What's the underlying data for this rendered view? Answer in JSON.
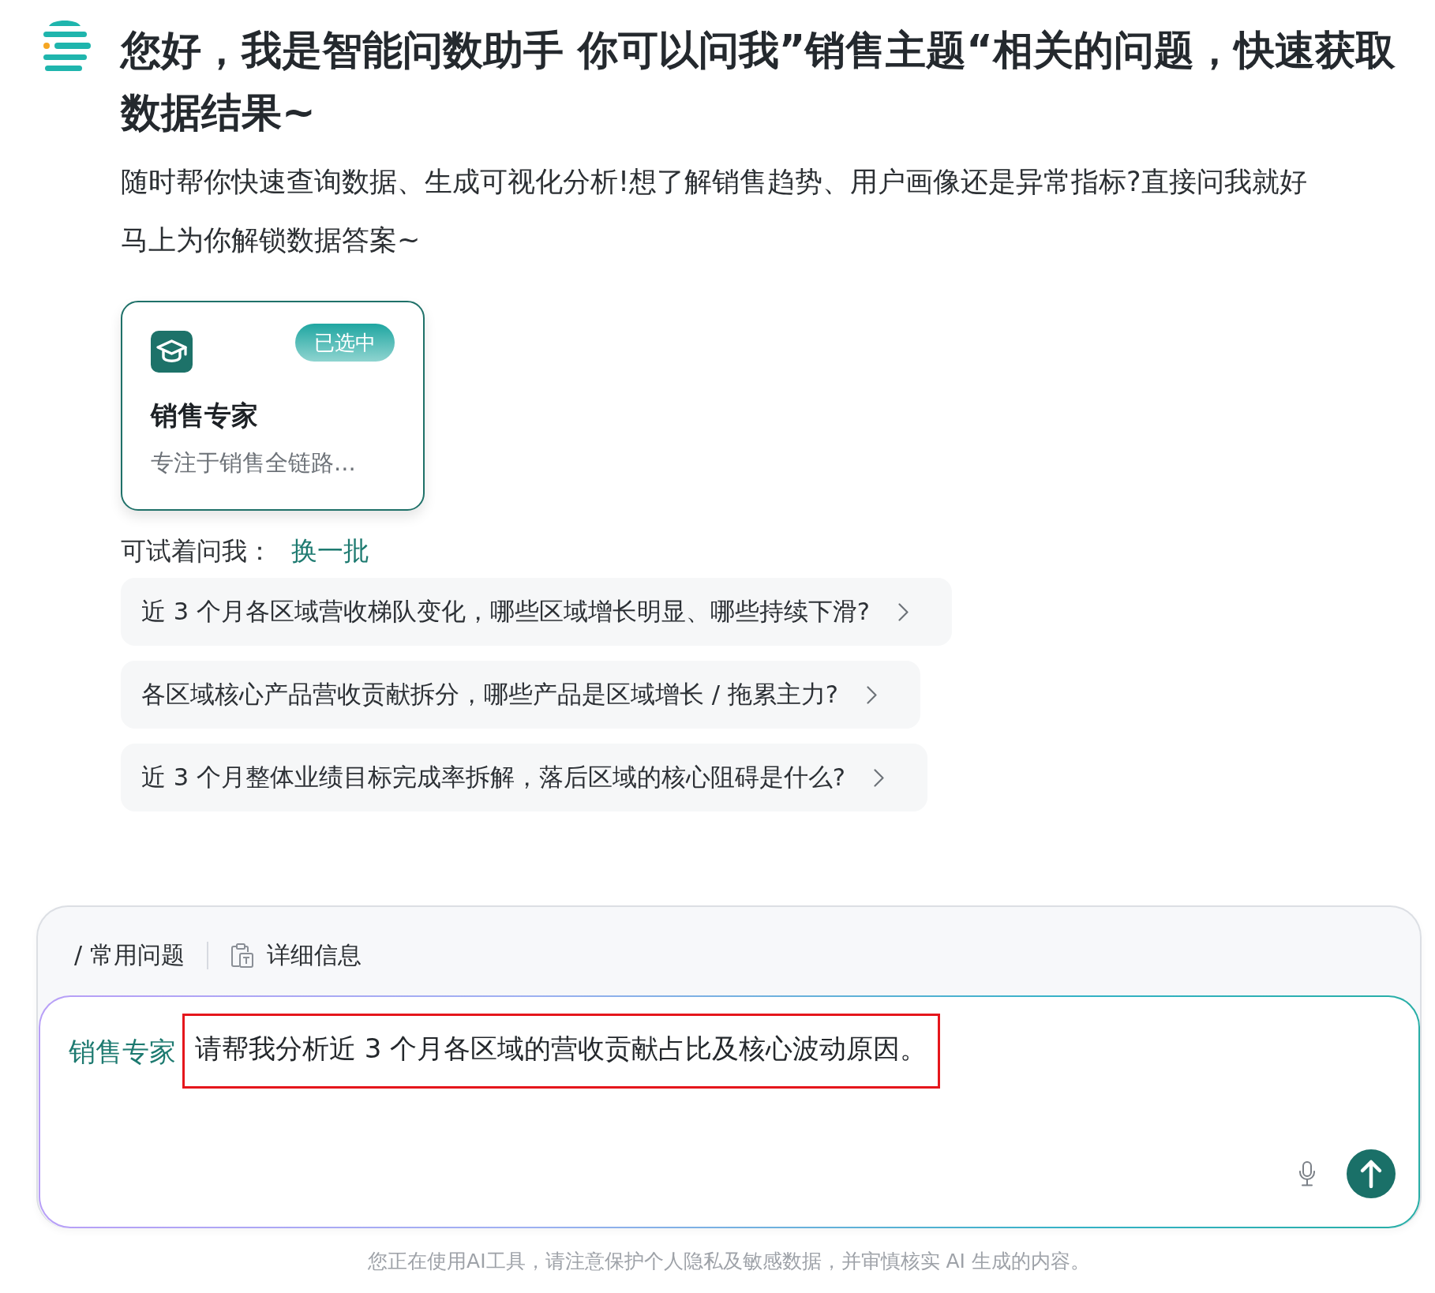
{
  "assistant": {
    "greeting": "您好，我是智能问数助手 你可以问我”销售主题“相关的问题，快速获取数据结果~",
    "intro": "随时帮你快速查询数据、生成可视化分析!想了解销售趋势、用户画像还是异常指标?直接问我就好马上为你解锁数据答案~"
  },
  "experts": [
    {
      "name": "销售专家",
      "description": "专注于销售全链路...",
      "badge": "已选中",
      "selected": true
    }
  ],
  "suggestions": {
    "label": "可试着问我：",
    "refresh": "换一批",
    "items": [
      "近 3 个月各区域营收梯队变化，哪些区域增长明显、哪些持续下滑?",
      "各区域核心产品营收贡献拆分，哪些产品是区域增长 / 拖累主力?",
      "近 3 个月整体业绩目标完成率拆解，落后区域的核心阻碍是什么?"
    ]
  },
  "composer": {
    "toolbar": [
      {
        "kind": "shortcut",
        "label": "/ 常用问题"
      },
      {
        "kind": "details",
        "label": "详细信息"
      }
    ],
    "agent_tag": "销售专家",
    "value": "请帮我分析近 3 个月各区域的营收贡献占比及核心波动原因。",
    "highlighted": true
  },
  "disclaimer": "您正在使用AI工具，请注意保护个人隐私及敏感数据，并审慎核实 AI 生成的内容。"
}
